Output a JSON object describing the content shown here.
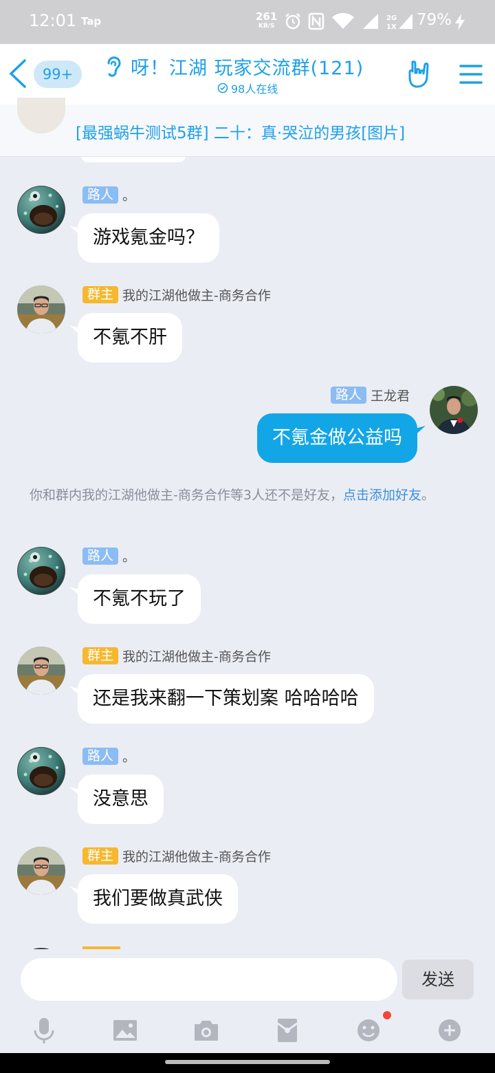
{
  "status_bar": {
    "time": "12:01",
    "app": "Tap",
    "speed_value": "261",
    "speed_unit": "KB/S",
    "battery": "79%"
  },
  "header": {
    "unread_badge": "99+",
    "group_title": "呀！江湖 玩家交流群(121)",
    "online_count": "98人在线",
    "accent_color": "#1ea0e8"
  },
  "pinned": {
    "text": "[最强蜗牛测试5群] 二十：真·哭泣的男孩[图片]"
  },
  "messages": [
    {
      "side": "left",
      "tag": "路人",
      "name": "。",
      "text": "游戏氪金吗？",
      "avatar": "fish-avatar"
    },
    {
      "side": "left",
      "tag": "群主",
      "name": "我的江湖他做主-商务合作",
      "text": "不氪不肝",
      "avatar": "owner-avatar"
    },
    {
      "side": "right",
      "tag": "路人",
      "name": "王龙君",
      "text": "不氪金做公益吗",
      "avatar": "self-avatar"
    },
    {
      "side": "left",
      "tag": "路人",
      "name": "。",
      "text": "不氪不玩了",
      "avatar": "fish-avatar"
    },
    {
      "side": "left",
      "tag": "群主",
      "name": "我的江湖他做主-商务合作",
      "text": "还是我来翻一下策划案 哈哈哈哈",
      "avatar": "owner-avatar"
    },
    {
      "side": "left",
      "tag": "路人",
      "name": "。",
      "text": "没意思",
      "avatar": "fish-avatar"
    },
    {
      "side": "left",
      "tag": "群主",
      "name": "我的江湖他做主-商务合作",
      "text": "我们要做真武侠",
      "avatar": "owner-avatar"
    }
  ],
  "system_note": {
    "text": "你和群内我的江湖他做主-商务合作等3人还不是好友，",
    "link": "点击添加好友",
    "end": "。"
  },
  "input": {
    "placeholder": "",
    "send_label": "发送"
  },
  "toolbar": [
    "mic-icon",
    "image-icon",
    "camera-icon",
    "redpacket-icon",
    "emoji-icon",
    "plus-icon"
  ]
}
